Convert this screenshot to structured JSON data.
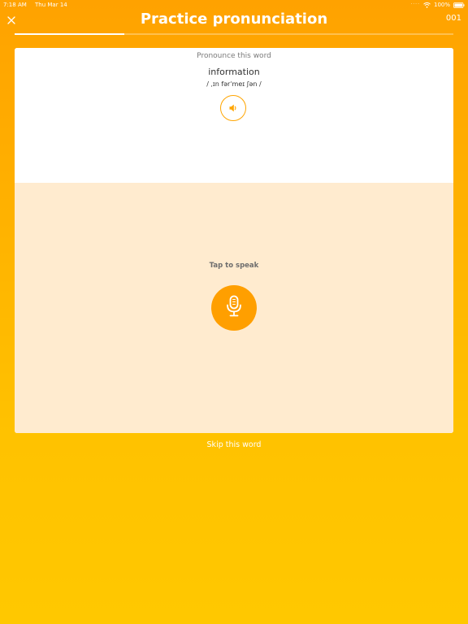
{
  "status_bar": {
    "time": "7:18 AM",
    "date": "Thu Mar 14",
    "battery": "100%"
  },
  "header": {
    "title": "Practice pronunciation",
    "counter": "001",
    "progress": 0.25
  },
  "card": {
    "instruction": "Pronounce this word",
    "word": "information",
    "phonetic": "/ ˌɪn fərˈmeɪ ʃən /",
    "tap_label": "Tap to speak"
  },
  "footer": {
    "skip_label": "Skip this word"
  },
  "colors": {
    "accent": "#ff9f00",
    "speak_panel": "#ffebcf"
  },
  "icons": {
    "close": "close-icon",
    "speaker": "speaker-icon",
    "microphone": "microphone-icon"
  }
}
